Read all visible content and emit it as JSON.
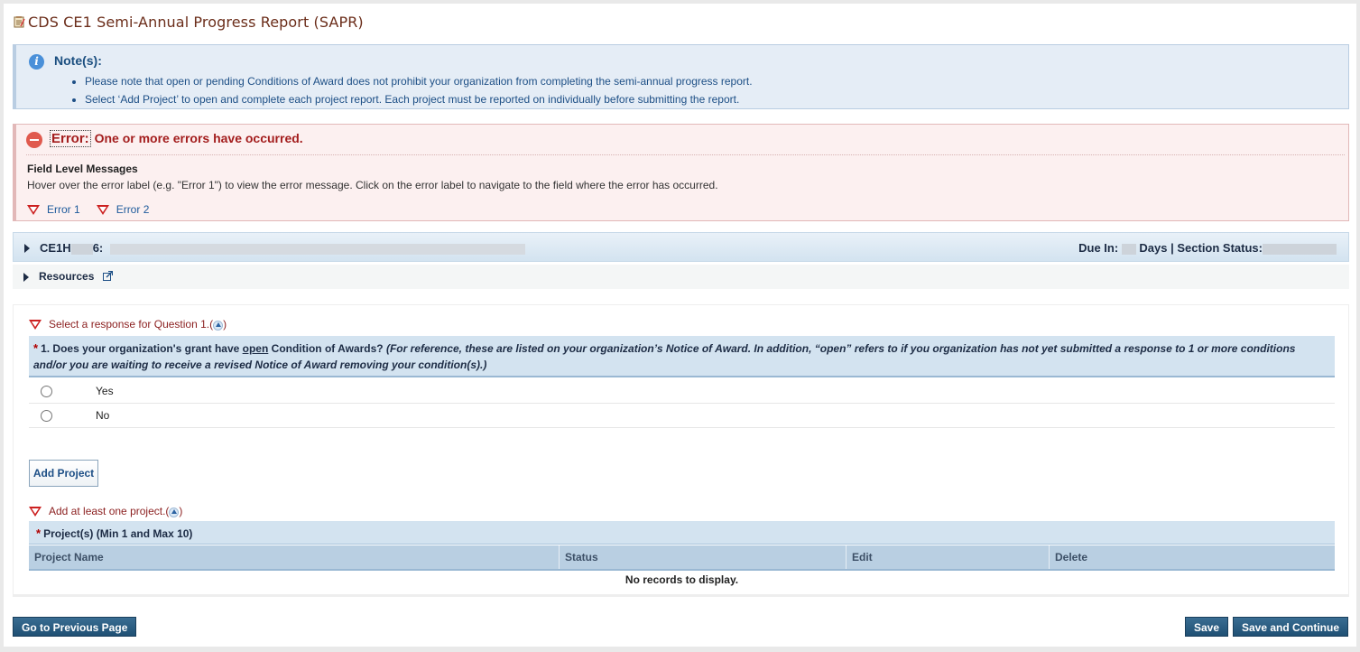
{
  "page": {
    "title": "CDS CE1 Semi-Annual Progress Report (SAPR)"
  },
  "notes": {
    "title": "Note(s):",
    "items": [
      "Please note that open or pending Conditions of Award does not prohibit your organization from completing the semi-annual progress report.",
      "Select ‘Add Project’ to open and complete each project report. Each project must be reported on individually before submitting the report."
    ]
  },
  "error": {
    "label": "Error:",
    "message": "One or more errors have occurred.",
    "field_title": "Field Level Messages",
    "field_desc": "Hover over the error label (e.g. \"Error 1\") to view the error message. Click on the error label to navigate to the field where the error has occurred.",
    "links": [
      "Error 1",
      "Error 2"
    ]
  },
  "section": {
    "id_prefix": "CE1H",
    "id_suffix": "6:",
    "due_prefix": "Due In:",
    "due_suffix": "Days | Section Status:"
  },
  "resources": {
    "label": "Resources"
  },
  "question1": {
    "validation": "Select a response for Question 1.",
    "text_before": "1. Does your organization's grant have ",
    "text_open": "open",
    "text_after": " Condition of Awards? ",
    "text_italic": "(For reference, these are listed on your organization’s Notice of Award. In addition, “open” refers to if you organization has not yet submitted a response to 1 or more conditions and/or you are waiting to receive a revised Notice of Award removing your condition(s).)",
    "options": [
      "Yes",
      "No"
    ]
  },
  "projects": {
    "add_button": "Add Project",
    "validation": "Add at least one project.",
    "header": "Project(s) (Min 1 and Max 10)",
    "columns": [
      "Project Name",
      "Status",
      "Edit",
      "Delete"
    ],
    "empty": "No records to display."
  },
  "footer": {
    "prev": "Go to Previous Page",
    "save": "Save",
    "save_continue": "Save and Continue"
  }
}
